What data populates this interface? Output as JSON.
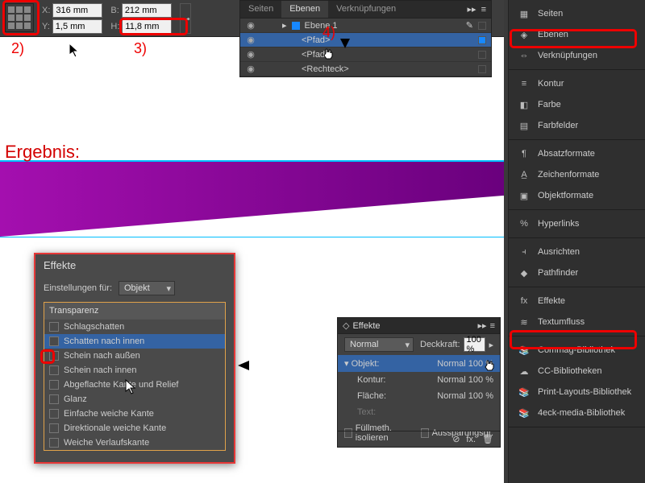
{
  "topbar": {
    "xlabel": "X:",
    "ylabel": "Y:",
    "wlabel": "B:",
    "hlabel": "H:",
    "x": "316 mm",
    "y": "1,5 mm",
    "w": "212 mm",
    "h": "11,8 mm"
  },
  "layers": {
    "tabs": [
      "Seiten",
      "Ebenen",
      "Verknüpfungen"
    ],
    "active_tab": 1,
    "rows": [
      {
        "name": "Ebene 1",
        "indent": 0,
        "sel": false,
        "pen": true
      },
      {
        "name": "<Pfad>",
        "indent": 1,
        "sel": true
      },
      {
        "name": "<Pfad>",
        "indent": 1,
        "sel": false
      },
      {
        "name": "<Rechteck>",
        "indent": 1,
        "sel": false
      }
    ]
  },
  "right_panels": {
    "groups": [
      [
        {
          "label": "Seiten",
          "icon": "pages"
        },
        {
          "label": "Ebenen",
          "icon": "layers",
          "hl": true
        },
        {
          "label": "Verknüpfungen",
          "icon": "links"
        }
      ],
      [
        {
          "label": "Kontur",
          "icon": "stroke"
        },
        {
          "label": "Farbe",
          "icon": "color"
        },
        {
          "label": "Farbfelder",
          "icon": "swatch"
        }
      ],
      [
        {
          "label": "Absatzformate",
          "icon": "para"
        },
        {
          "label": "Zeichenformate",
          "icon": "char"
        },
        {
          "label": "Objektformate",
          "icon": "obj"
        }
      ],
      [
        {
          "label": "Hyperlinks",
          "icon": "hyper"
        }
      ],
      [
        {
          "label": "Ausrichten",
          "icon": "align"
        },
        {
          "label": "Pathfinder",
          "icon": "path"
        }
      ],
      [
        {
          "label": "Effekte",
          "icon": "fx",
          "hl": true
        },
        {
          "label": "Textumfluss",
          "icon": "wrap"
        }
      ],
      [
        {
          "label": "Commag-Bibliothek",
          "icon": "lib"
        },
        {
          "label": "CC-Bibliotheken",
          "icon": "cc"
        },
        {
          "label": "Print-Layouts-Bibliothek",
          "icon": "lib"
        },
        {
          "label": "4eck-media-Bibliothek",
          "icon": "lib"
        }
      ]
    ]
  },
  "canvas": {
    "ergebnis_label": "Ergebnis:"
  },
  "effekte_dialog": {
    "title": "Effekte",
    "settings_for_label": "Einstellungen für:",
    "settings_for_value": "Objekt",
    "category": "Transparenz",
    "items": [
      "Schlagschatten",
      "Schatten nach innen",
      "Schein nach außen",
      "Schein nach innen",
      "Abgeflachte Kante und Relief",
      "Glanz",
      "Einfache weiche Kante",
      "Direktionale weiche Kante",
      "Weiche Verlaufskante"
    ],
    "selected_index": 1
  },
  "effekte_panel": {
    "title": "Effekte",
    "blend": "Normal",
    "opacity_label": "Deckkraft:",
    "opacity_value": "100 %",
    "obj_label": "Objekt:",
    "obj_value": "Normal 100 %",
    "stroke_label": "Kontur:",
    "stroke_value": "Normal 100 %",
    "fill_label": "Fläche:",
    "fill_value": "Normal 100 %",
    "text_label": "Text:",
    "iso_label": "Füllmeth. isolieren",
    "knock_label": "Aussparungsgr."
  },
  "annotations": {
    "a2": "2)",
    "a3": "3)",
    "a4": "4)"
  }
}
